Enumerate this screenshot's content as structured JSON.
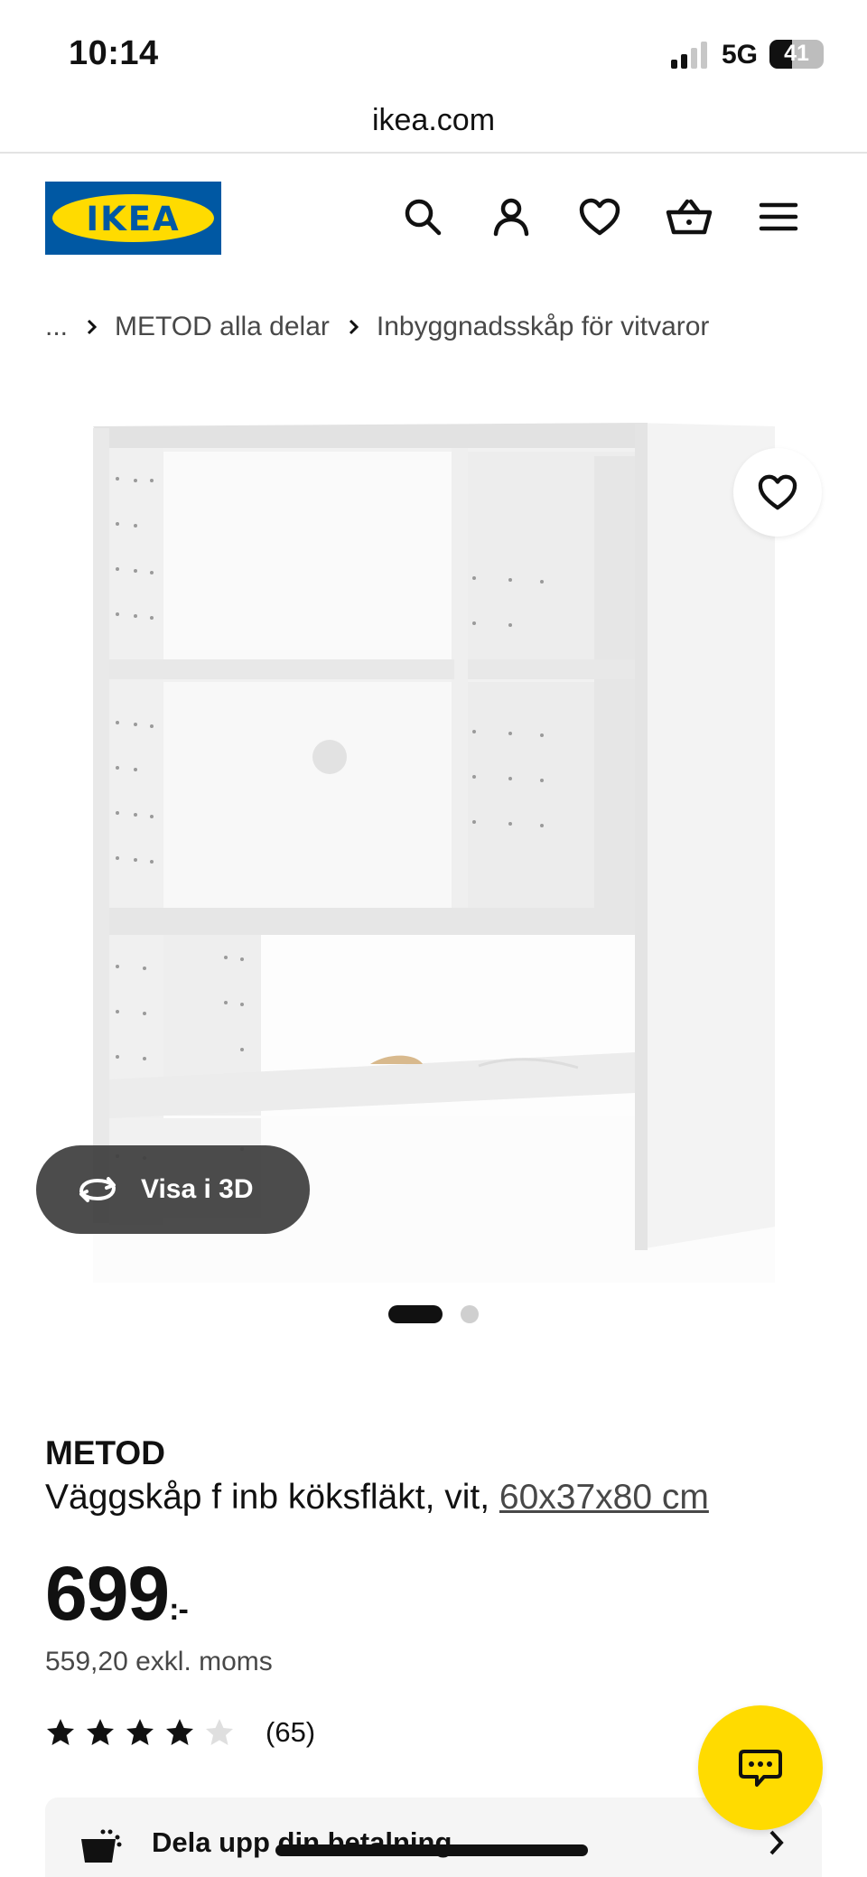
{
  "status_bar": {
    "time": "10:14",
    "network": "5G",
    "battery": "41",
    "battery_level": 0.41
  },
  "browser": {
    "url": "ikea.com"
  },
  "header": {
    "logo_text": "IKEA",
    "brand_colors": {
      "blue": "#0058a3",
      "yellow": "#ffdb00"
    },
    "icons": [
      "search-icon",
      "account-icon",
      "heart-icon",
      "shopping-bag-icon",
      "menu-icon"
    ]
  },
  "breadcrumb": {
    "ellipsis": "...",
    "items": [
      "METOD alla delar",
      "Inbyggnadsskåp för vitvaror"
    ]
  },
  "gallery": {
    "view_3d_label": "Visa i 3D",
    "current_image": 1,
    "image_count": 2
  },
  "product": {
    "brand": "METOD",
    "description": "Väggskåp f inb köksfläkt, vit,",
    "dimensions": "60x37x80 cm",
    "price": "699",
    "price_suffix": ":-",
    "price_ex_vat": "559,20 exkl. moms",
    "rating": 4,
    "rating_max": 5,
    "review_count": "(65)"
  },
  "payment": {
    "label": "Dela upp din betalning"
  }
}
